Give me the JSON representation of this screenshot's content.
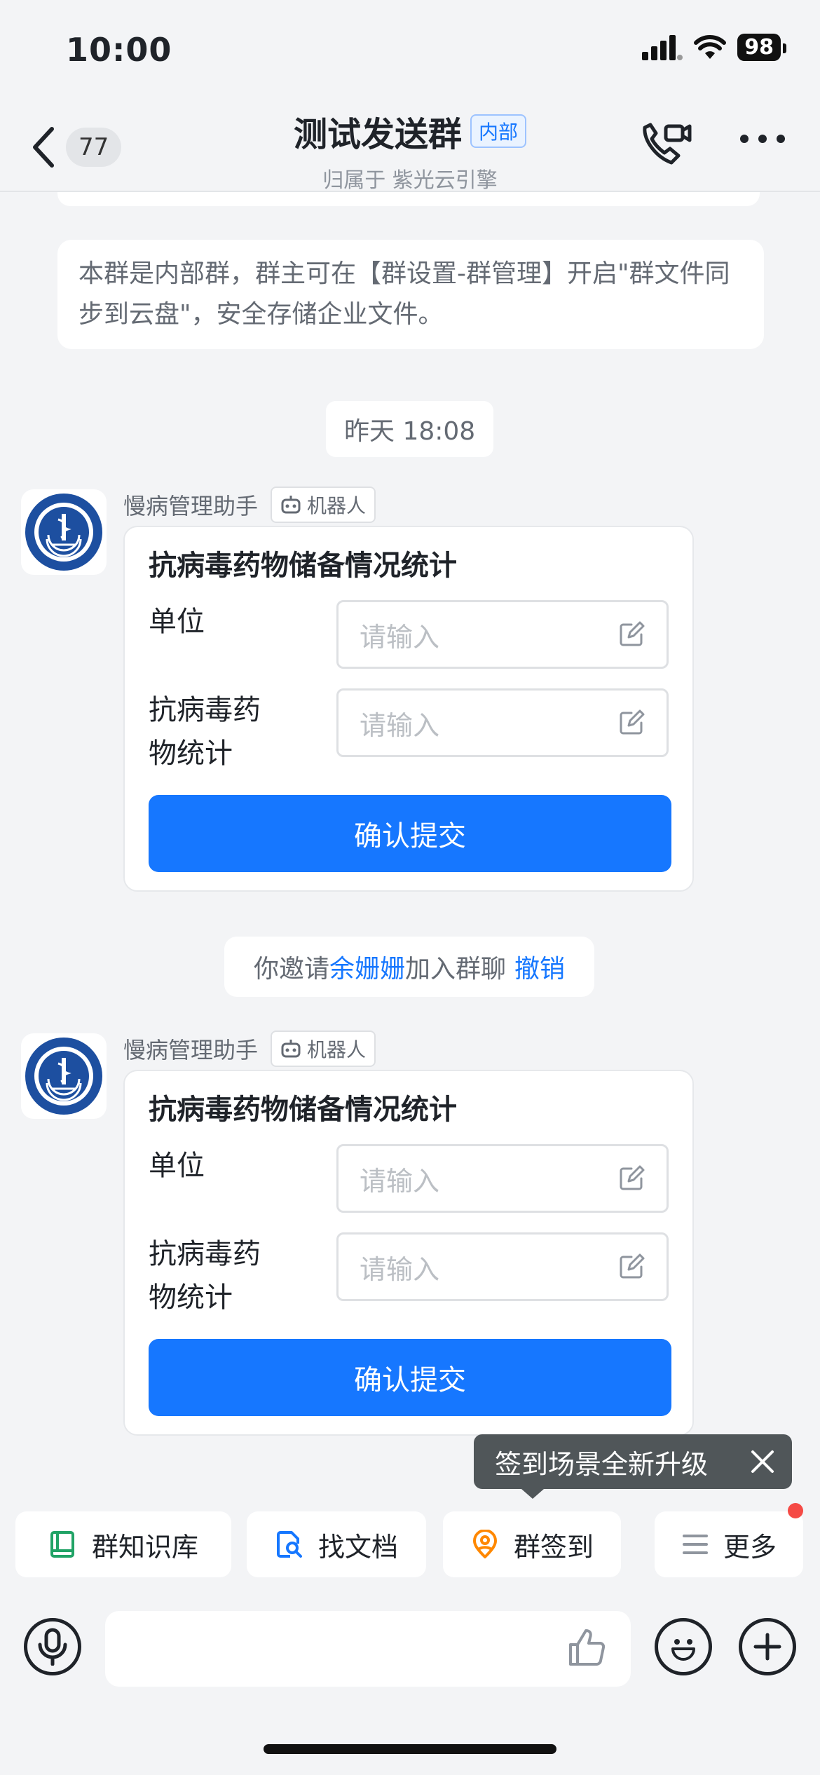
{
  "status_bar": {
    "time": "10:00",
    "battery": "98"
  },
  "header": {
    "unread_count": "77",
    "title": "测试发送群",
    "badge": "内部",
    "subtitle": "归属于 紫光云引擎"
  },
  "notice": "本群是内部群，群主可在【群设置-群管理】开启\"群文件同步到云盘\"，安全存储企业文件。",
  "time_divider": "昨天 18:08",
  "messages": [
    {
      "sender": "慢病管理助手",
      "tag": "机器人",
      "card": {
        "title": "抗病毒药物储备情况统计",
        "fields": [
          {
            "label": "单位",
            "placeholder": "请输入"
          },
          {
            "label": "抗病毒药物统计",
            "label_line1": "抗病毒药",
            "label_line2": "物统计",
            "placeholder": "请输入"
          }
        ],
        "submit": "确认提交"
      }
    },
    {
      "sender": "慢病管理助手",
      "tag": "机器人",
      "card": {
        "title": "抗病毒药物储备情况统计",
        "fields": [
          {
            "label": "单位",
            "placeholder": "请输入"
          },
          {
            "label": "抗病毒药物统计",
            "label_line1": "抗病毒药",
            "label_line2": "物统计",
            "placeholder": "请输入"
          }
        ],
        "submit": "确认提交"
      }
    }
  ],
  "system_event": {
    "prefix": "你邀请",
    "name": "余姗姗",
    "suffix": "加入群聊",
    "action": "撤销"
  },
  "tooltip": "签到场景全新升级",
  "quick_actions": [
    {
      "label": "群知识库",
      "icon": "book-icon",
      "color": "#21A366"
    },
    {
      "label": "找文档",
      "icon": "doc-search-icon",
      "color": "#1677FF"
    },
    {
      "label": "群签到",
      "icon": "location-icon",
      "color": "#FF8800"
    },
    {
      "label": "更多",
      "icon": "menu-icon",
      "color": "#8F959E"
    }
  ],
  "colors": {
    "accent": "#1677FF",
    "background": "#F3F4F6",
    "notification_dot": "#F54A45"
  }
}
